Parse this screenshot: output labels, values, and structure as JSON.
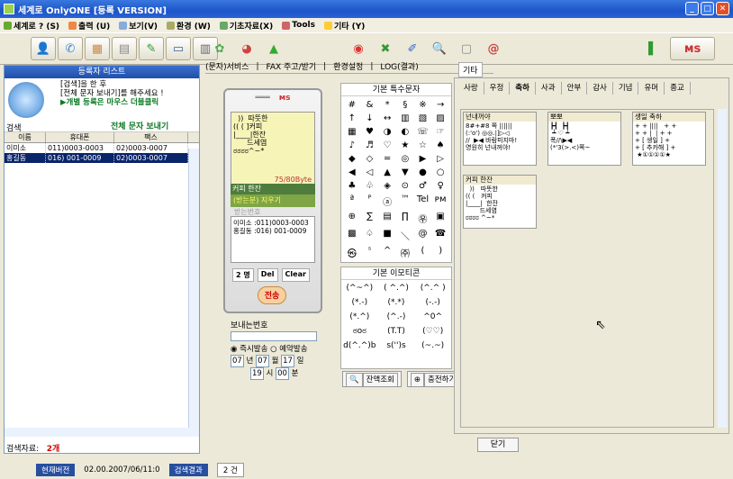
{
  "window": {
    "title": "세계로 OnlyONE [등록 VERSION]"
  },
  "menu": [
    "세계로 ? (S)",
    "출력 (U)",
    "보기(V)",
    "환경 (W)",
    "기초자료(X)",
    "Tools",
    "기타 (Y)"
  ],
  "left": {
    "header": "등록자 리스트",
    "search_label": "검색",
    "instructions": [
      "[검색]을 한 후",
      "[전체 문자 보내기]를 해주세요 !",
      "▶개별 등록은 마우스 더블클릭"
    ],
    "send_all": "전체 문자 보내기",
    "columns": [
      "이름",
      "휴대폰",
      "팩스"
    ],
    "rows": [
      {
        "name": "이미소",
        "mobile": "011)0003-0003",
        "fax": "02)0003-0007"
      },
      {
        "name": "홍길동",
        "mobile": "016) 001-0009",
        "fax": "02)0003-0007"
      }
    ],
    "count_label": "검색자료:",
    "count_value": "2개"
  },
  "tabs": [
    "(문자)서비스",
    "FAX 주고/받기",
    "환경설정",
    "LOG(결과)"
  ],
  "phone": {
    "screen_lines": [
      "  ))  따뜻한",
      "(( ( ]커피",
      "|____|한잔",
      "      드세염",
      "ಠಠಠಠ^~*"
    ],
    "bytes": "75/80Byte",
    "paste_label": "커피 한잔",
    "recv_label": "(받는분) 지우기",
    "recv_title": "받는번호",
    "recv_list": [
      "이미소  :011)0003-0003",
      "홍길동  :016) 001-0009"
    ],
    "count": "2 명",
    "del": "Del",
    "clear": "Clear",
    "send": "전송"
  },
  "sender": {
    "label": "보내는번호",
    "opt_now": "즉시발송",
    "opt_reserve": "예약발송",
    "y": "07",
    "y_unit": "년",
    "m": "07",
    "m_unit": "월",
    "d": "17",
    "d_unit": "일",
    "h": "19",
    "h_unit": "시",
    "mi": "00",
    "mi_unit": "분"
  },
  "special": {
    "header": "기본 특수문자",
    "chars": [
      "#",
      "&",
      "*",
      "§",
      "※",
      "→",
      "↑",
      "↓",
      "↔",
      "▥",
      "▧",
      "▨",
      "▦",
      "♥",
      "◑",
      "◐",
      "☏",
      "☞",
      "♪",
      "♬",
      "♡",
      "★",
      "☆",
      "♠",
      "◆",
      "◇",
      "═",
      "◎",
      "▶",
      "▷",
      "◀",
      "◁",
      "▲",
      "▼",
      "●",
      "○",
      "♣",
      "♧",
      "◈",
      "⊙",
      "♂",
      "♀",
      "ª",
      "ᴾ",
      "ⓐ",
      "™",
      "Tel",
      "ᴘᴍ",
      "⊕",
      "∑",
      "▤",
      "∏",
      "㉾",
      "▣",
      "▩",
      "♤",
      "■",
      "＼",
      "@",
      "☎",
      "㉿",
      "ˢ",
      "^",
      "㈜",
      "(",
      ")"
    ]
  },
  "emoticon": {
    "header": "기본 이모티콘",
    "items": [
      "(^~^)",
      "( ^.^)",
      "(^.^ )",
      "(*.-)",
      "(*.*)",
      "(-.-)",
      "(*.^)",
      "(^.-)",
      "^0^",
      "ಠoಠ",
      "(T.T)",
      "(♡♡)",
      "d(^.^)b",
      "s('')s",
      "(~.~)"
    ]
  },
  "bottom_buttons": [
    "잔액조회",
    "충전하기"
  ],
  "categories": {
    "group": "기타",
    "tabs": [
      "사랑",
      "우정",
      "축하",
      "사과",
      "안부",
      "감사",
      "기념",
      "유머",
      "종교"
    ],
    "active": "축하"
  },
  "cards": [
    {
      "title": "넌내꺼야",
      "body": "8#+#8 쪽 ||||||\n(:'o') ◎◎.|]▷◁\n//  ▶◀ 바람피지마!\n영원히 넌내꺼야!"
    },
    {
      "title": "뽀뽀",
      "body": "┣┫  ┣┫\n ┷ ♡ ┷\n폭//\\▶◀\n(*'3(>.<)쪽~"
    },
    {
      "title": "생일 축하",
      "body": "+ + ||||   + +\n+ + |  | + +\n+ [ 생일 ] +\n+ [ 추카해 ] +\n ★①①①①★"
    },
    {
      "title": "커피 한잔",
      "body:": "",
      "body": "  ))   따뜻한\n(( (   커피\n|____|  한잔\n       드세염\nಠಠಠಠ ^~*"
    }
  ],
  "close": "닫기",
  "status": {
    "ver_label": "현재버전",
    "ver": "02.00.2007/06/11:0",
    "result_label": "검색결과",
    "result": "2 건"
  }
}
